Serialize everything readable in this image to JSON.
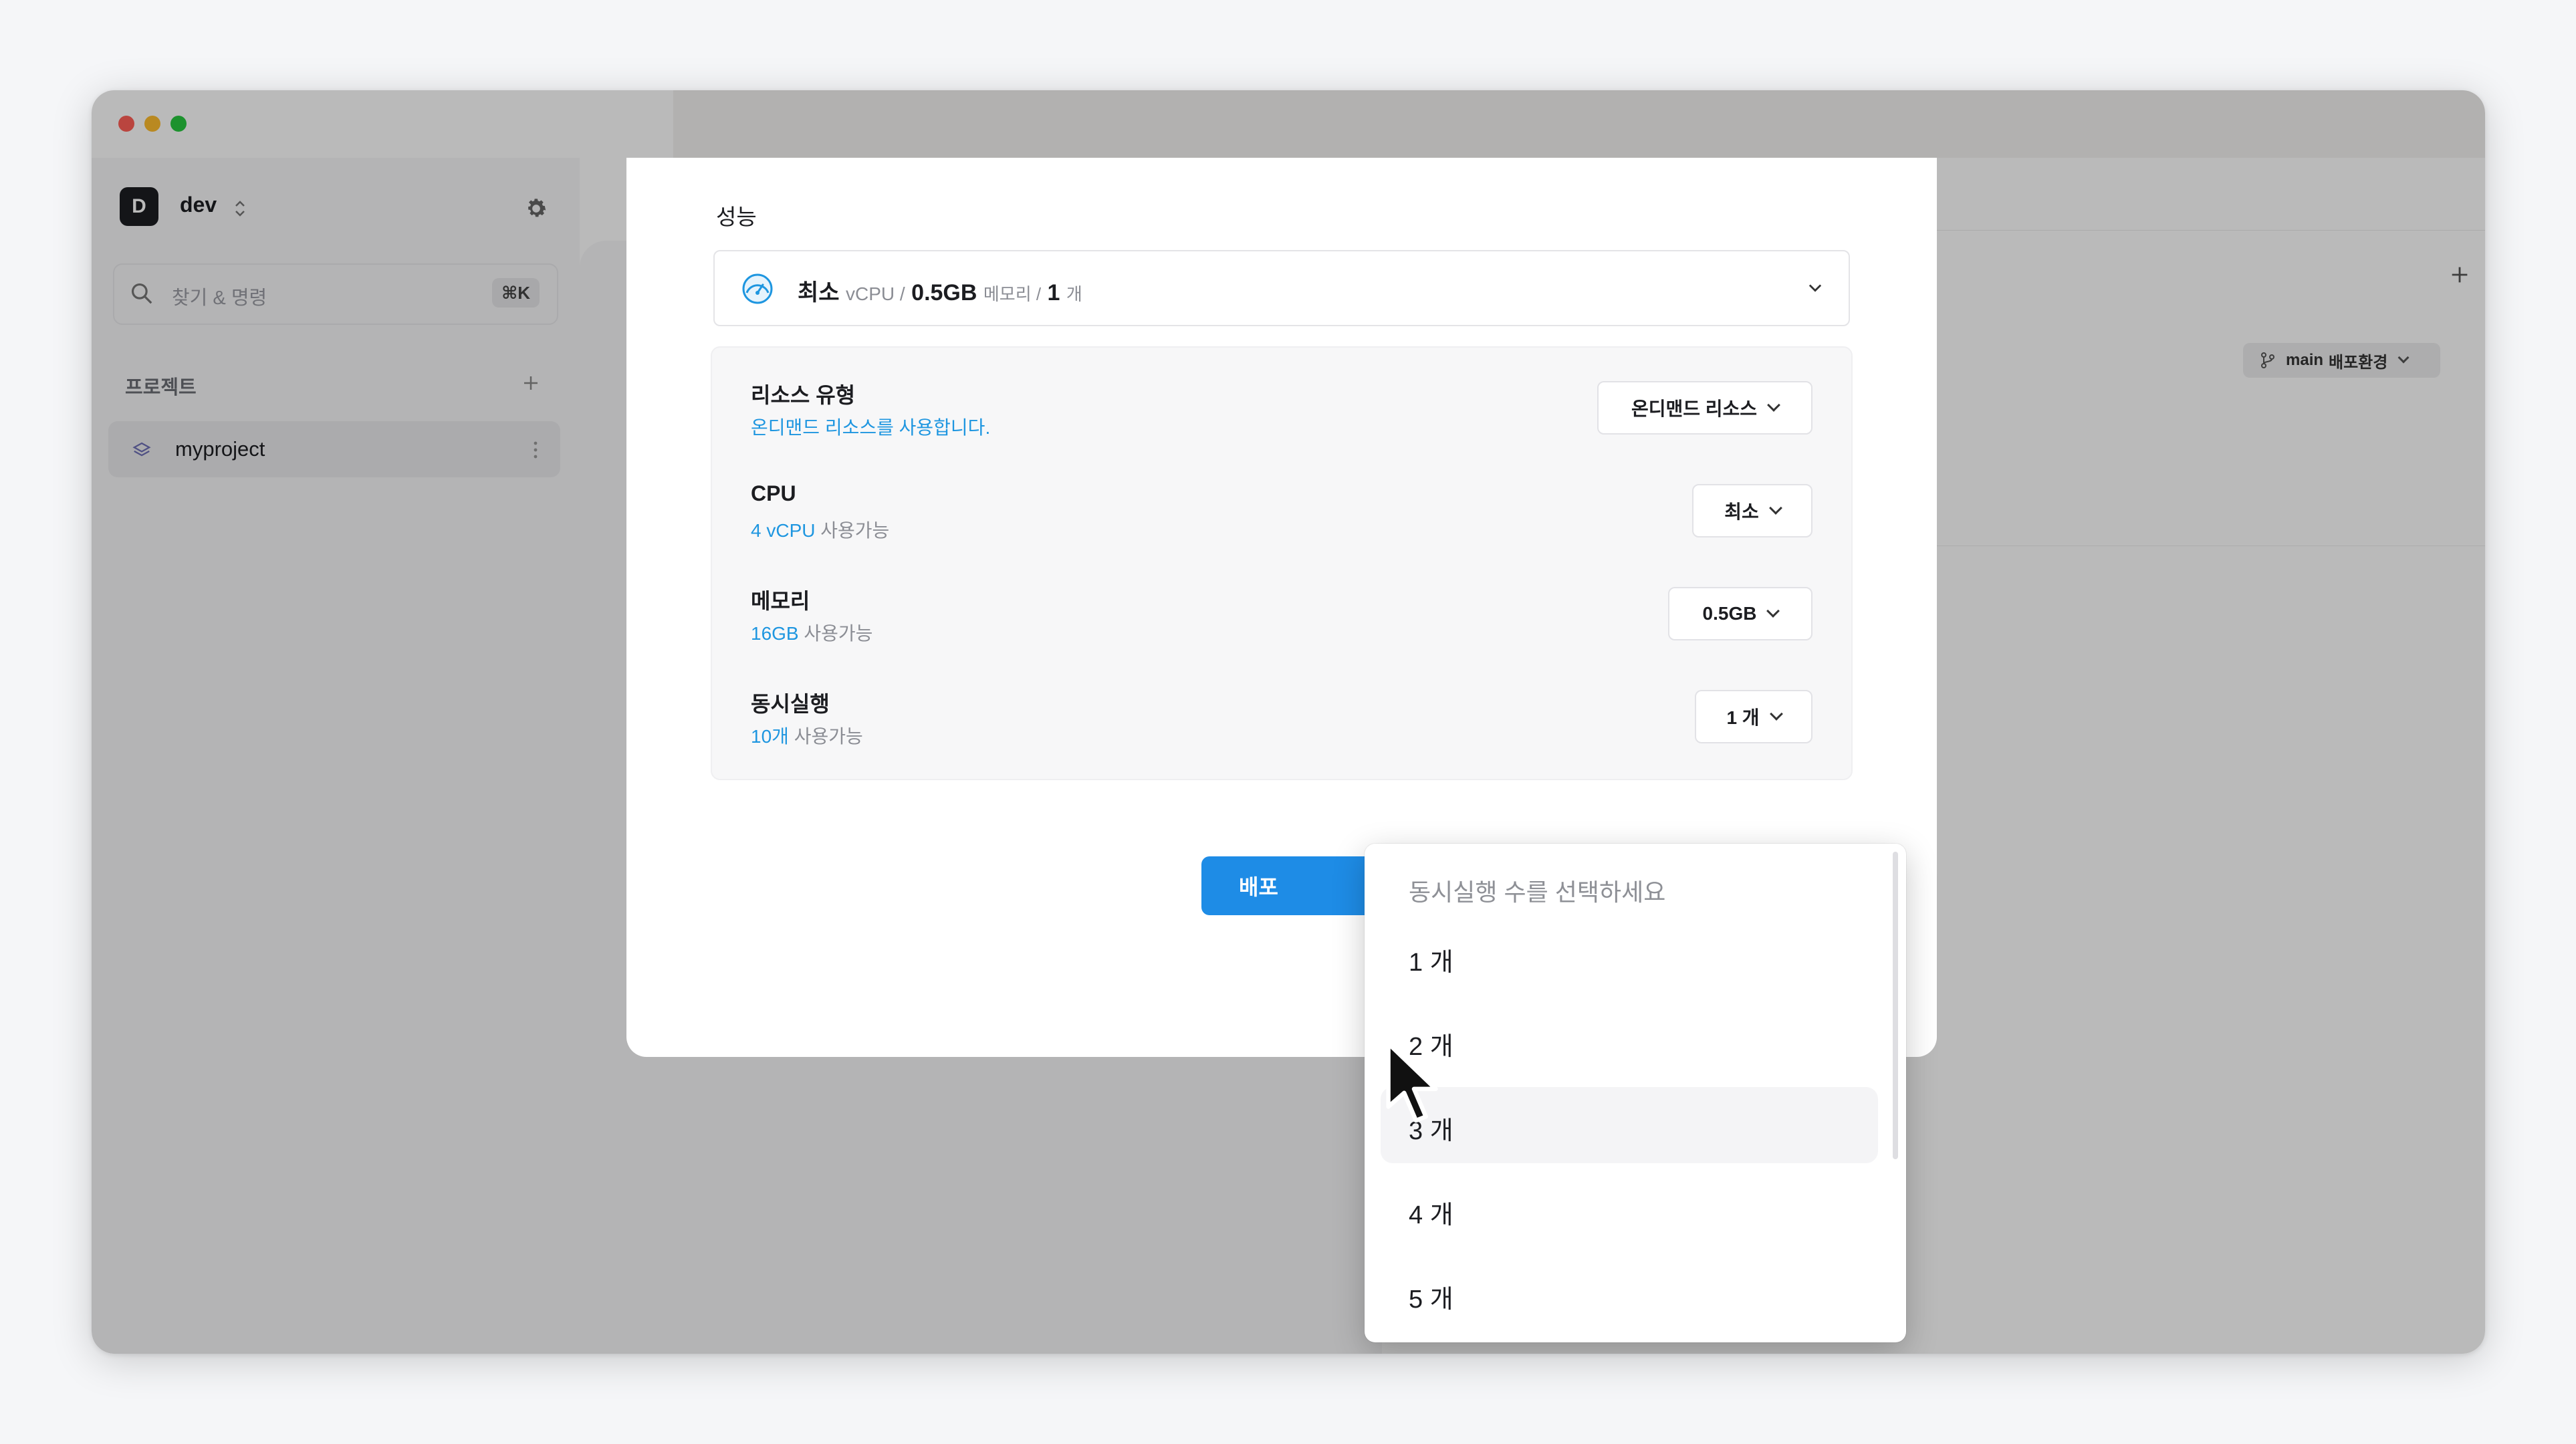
{
  "sidebar": {
    "workspace_initial": "D",
    "workspace_name": "dev",
    "search_placeholder": "찾기 & 명령",
    "search_shortcut": "⌘K",
    "projects_heading": "프로젝트",
    "projects": [
      {
        "label": "myproject"
      }
    ]
  },
  "header": {
    "branch_name": "main",
    "branch_env": "배포환경"
  },
  "modal": {
    "section_title": "성능",
    "summary": {
      "cpu_value": "최소",
      "cpu_unit": "vCPU /",
      "memory_value": "0.5GB",
      "memory_unit": "메모리 /",
      "concurrency_value": "1",
      "concurrency_unit": "개"
    },
    "resources": [
      {
        "label": "리소스 유형",
        "sub_highlight": "온디맨드 리소스를 사용합니다.",
        "sub_rest": "",
        "selected": "온디맨드 리소스"
      },
      {
        "label": "CPU",
        "sub_highlight": "4 vCPU",
        "sub_rest": "사용가능",
        "selected": "최소"
      },
      {
        "label": "메모리",
        "sub_highlight": "16GB",
        "sub_rest": "사용가능",
        "selected": "0.5GB"
      },
      {
        "label": "동시실행",
        "sub_highlight": "10개",
        "sub_rest": "사용가능",
        "selected": "1 개"
      }
    ],
    "deploy_button_label": "배포"
  },
  "concurrency_dropdown": {
    "title": "동시실행 수를 선택하세요",
    "options": [
      "1 개",
      "2 개",
      "3 개",
      "4 개",
      "5 개"
    ],
    "hovered_index": 2
  },
  "colors": {
    "accent": "#1e96e0",
    "primary_button": "#1e8ce6",
    "close_light": "#ff5f57",
    "minimize_light": "#febc2e",
    "zoom_light": "#28c840"
  }
}
